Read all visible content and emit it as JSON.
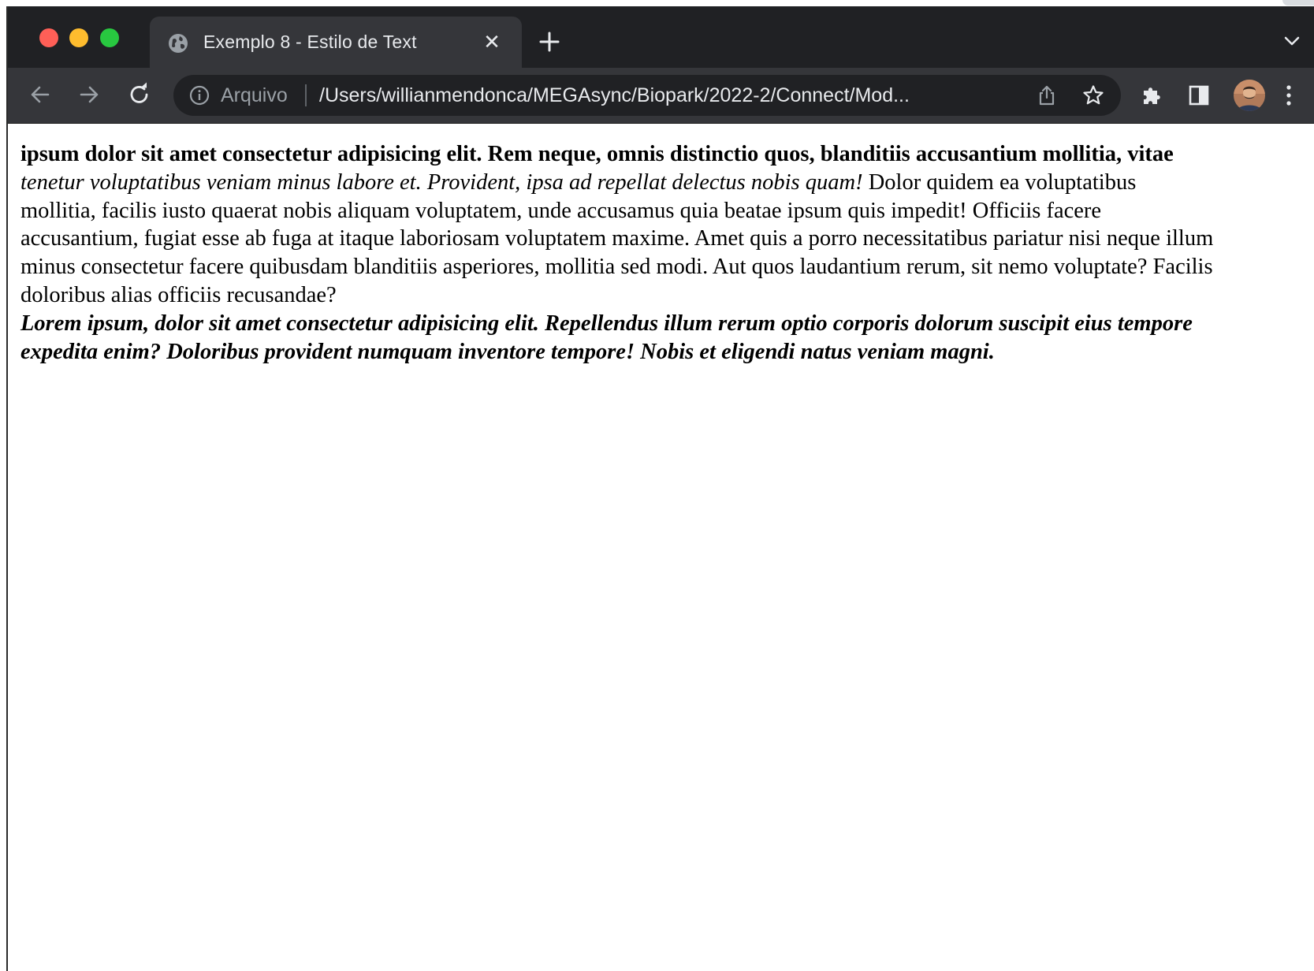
{
  "window": {
    "tab": {
      "title": "Exemplo 8 - Estilo de Text",
      "close_label": "✕"
    },
    "toolbar": {
      "scheme_label": "Arquivo",
      "url": "/Users/willianmendonca/MEGAsync/Biopark/2022-2/Connect/Mod..."
    }
  },
  "content": {
    "lines": [
      {
        "style": "bold",
        "text": "ipsum dolor sit amet consectetur adipisicing elit. Rem neque, omnis distinctio quos, blanditiis accusantium mollitia, vitae"
      },
      {
        "style": "mixed",
        "italic_text": "tenetur voluptatibus veniam minus labore et. Provident, ipsa ad repellat delectus nobis quam!",
        "normal_text": " Dolor quidem ea voluptatibus"
      },
      {
        "style": "normal",
        "text": "mollitia, facilis iusto quaerat nobis aliquam voluptatem, unde accusamus quia beatae ipsum quis impedit! Officiis facere"
      },
      {
        "style": "normal",
        "text": "accusantium, fugiat esse ab fuga at itaque laboriosam voluptatem maxime. Amet quis a porro necessitatibus pariatur nisi neque illum"
      },
      {
        "style": "normal",
        "text": "minus consectetur facere quibusdam blanditiis asperiores, mollitia sed modi. Aut quos laudantium rerum, sit nemo voluptate? Facilis"
      },
      {
        "style": "normal",
        "text": "doloribus alias officiis recusandae?"
      },
      {
        "style": "bold-italic",
        "text": "Lorem ipsum, dolor sit amet consectetur adipisicing elit. Repellendus illum rerum optio corporis dolorum suscipit eius tempore"
      },
      {
        "style": "bold-italic",
        "text": "expedita enim? Doloribus provident numquam inventore tempore! Nobis et eligendi natus veniam magni."
      }
    ]
  },
  "icons": {
    "tab_favicon": "globe-icon",
    "new_tab": "plus-icon",
    "tab_search": "chevron-down-icon",
    "back": "arrow-left-icon",
    "forward": "arrow-right-icon",
    "reload": "reload-icon",
    "site_info": "info-icon",
    "share": "share-icon",
    "bookmark": "star-icon",
    "extensions": "puzzle-icon",
    "side_panel": "side-panel-icon",
    "profile": "avatar",
    "menu": "kebab-menu-icon"
  },
  "colors": {
    "tabstrip_bg": "#202124",
    "toolbar_bg": "#35363a",
    "omnibox_bg": "#202124",
    "text_light": "#e8eaed",
    "text_muted": "#9aa0a6",
    "traffic_close": "#ff5f57",
    "traffic_minimize": "#febc2e",
    "traffic_maximize": "#28c840"
  }
}
